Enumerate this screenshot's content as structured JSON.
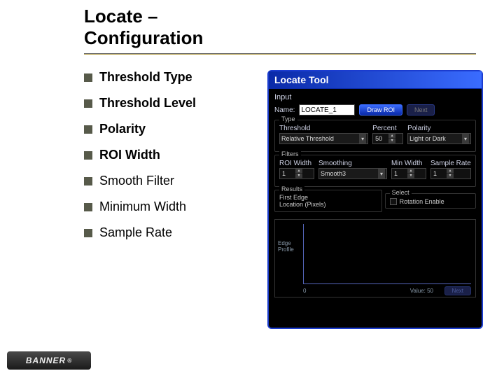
{
  "slide": {
    "title_line1": "Locate –",
    "title_line2": "Configuration"
  },
  "bullets": [
    {
      "text": "Threshold Type",
      "bold": true
    },
    {
      "text": "Threshold Level",
      "bold": true
    },
    {
      "text": "Polarity",
      "bold": true
    },
    {
      "text": "ROI Width",
      "bold": true
    },
    {
      "text": "Smooth Filter",
      "bold": false
    },
    {
      "text": "Minimum Width",
      "bold": false
    },
    {
      "text": "Sample Rate",
      "bold": false
    }
  ],
  "panel": {
    "title": "Locate Tool",
    "input_label": "Input",
    "name_label": "Name:",
    "name_value": "LOCATE_1",
    "draw_roi": "Draw ROI",
    "next": "Next",
    "type_group": "Type",
    "threshold_label": "Threshold",
    "threshold_value": "Relative Threshold",
    "percent_label": "Percent",
    "percent_value": "50",
    "polarity_label": "Polarity",
    "polarity_value": "Light or Dark",
    "filters_group": "Filters",
    "roi_width_label": "ROI Width",
    "roi_width_value": "1",
    "smoothing_label": "Smoothing",
    "smoothing_value": "Smooth3",
    "min_width_label": "Min Width",
    "min_width_value": "1",
    "sample_rate_label": "Sample Rate",
    "sample_rate_value": "1",
    "results_group": "Results",
    "results_text_l1": "First Edge",
    "results_text_l2": "Location (Pixels)",
    "select_group": "Select",
    "rotation_enable": "Rotation Enable",
    "graph_ylabel_l1": "Edge",
    "graph_ylabel_l2": "Profile",
    "graph_xzero": "0",
    "graph_value_label": "Value:",
    "graph_value": "50",
    "graph_next": "Next"
  },
  "logo": {
    "text": "BANNER",
    "reg": "®"
  }
}
